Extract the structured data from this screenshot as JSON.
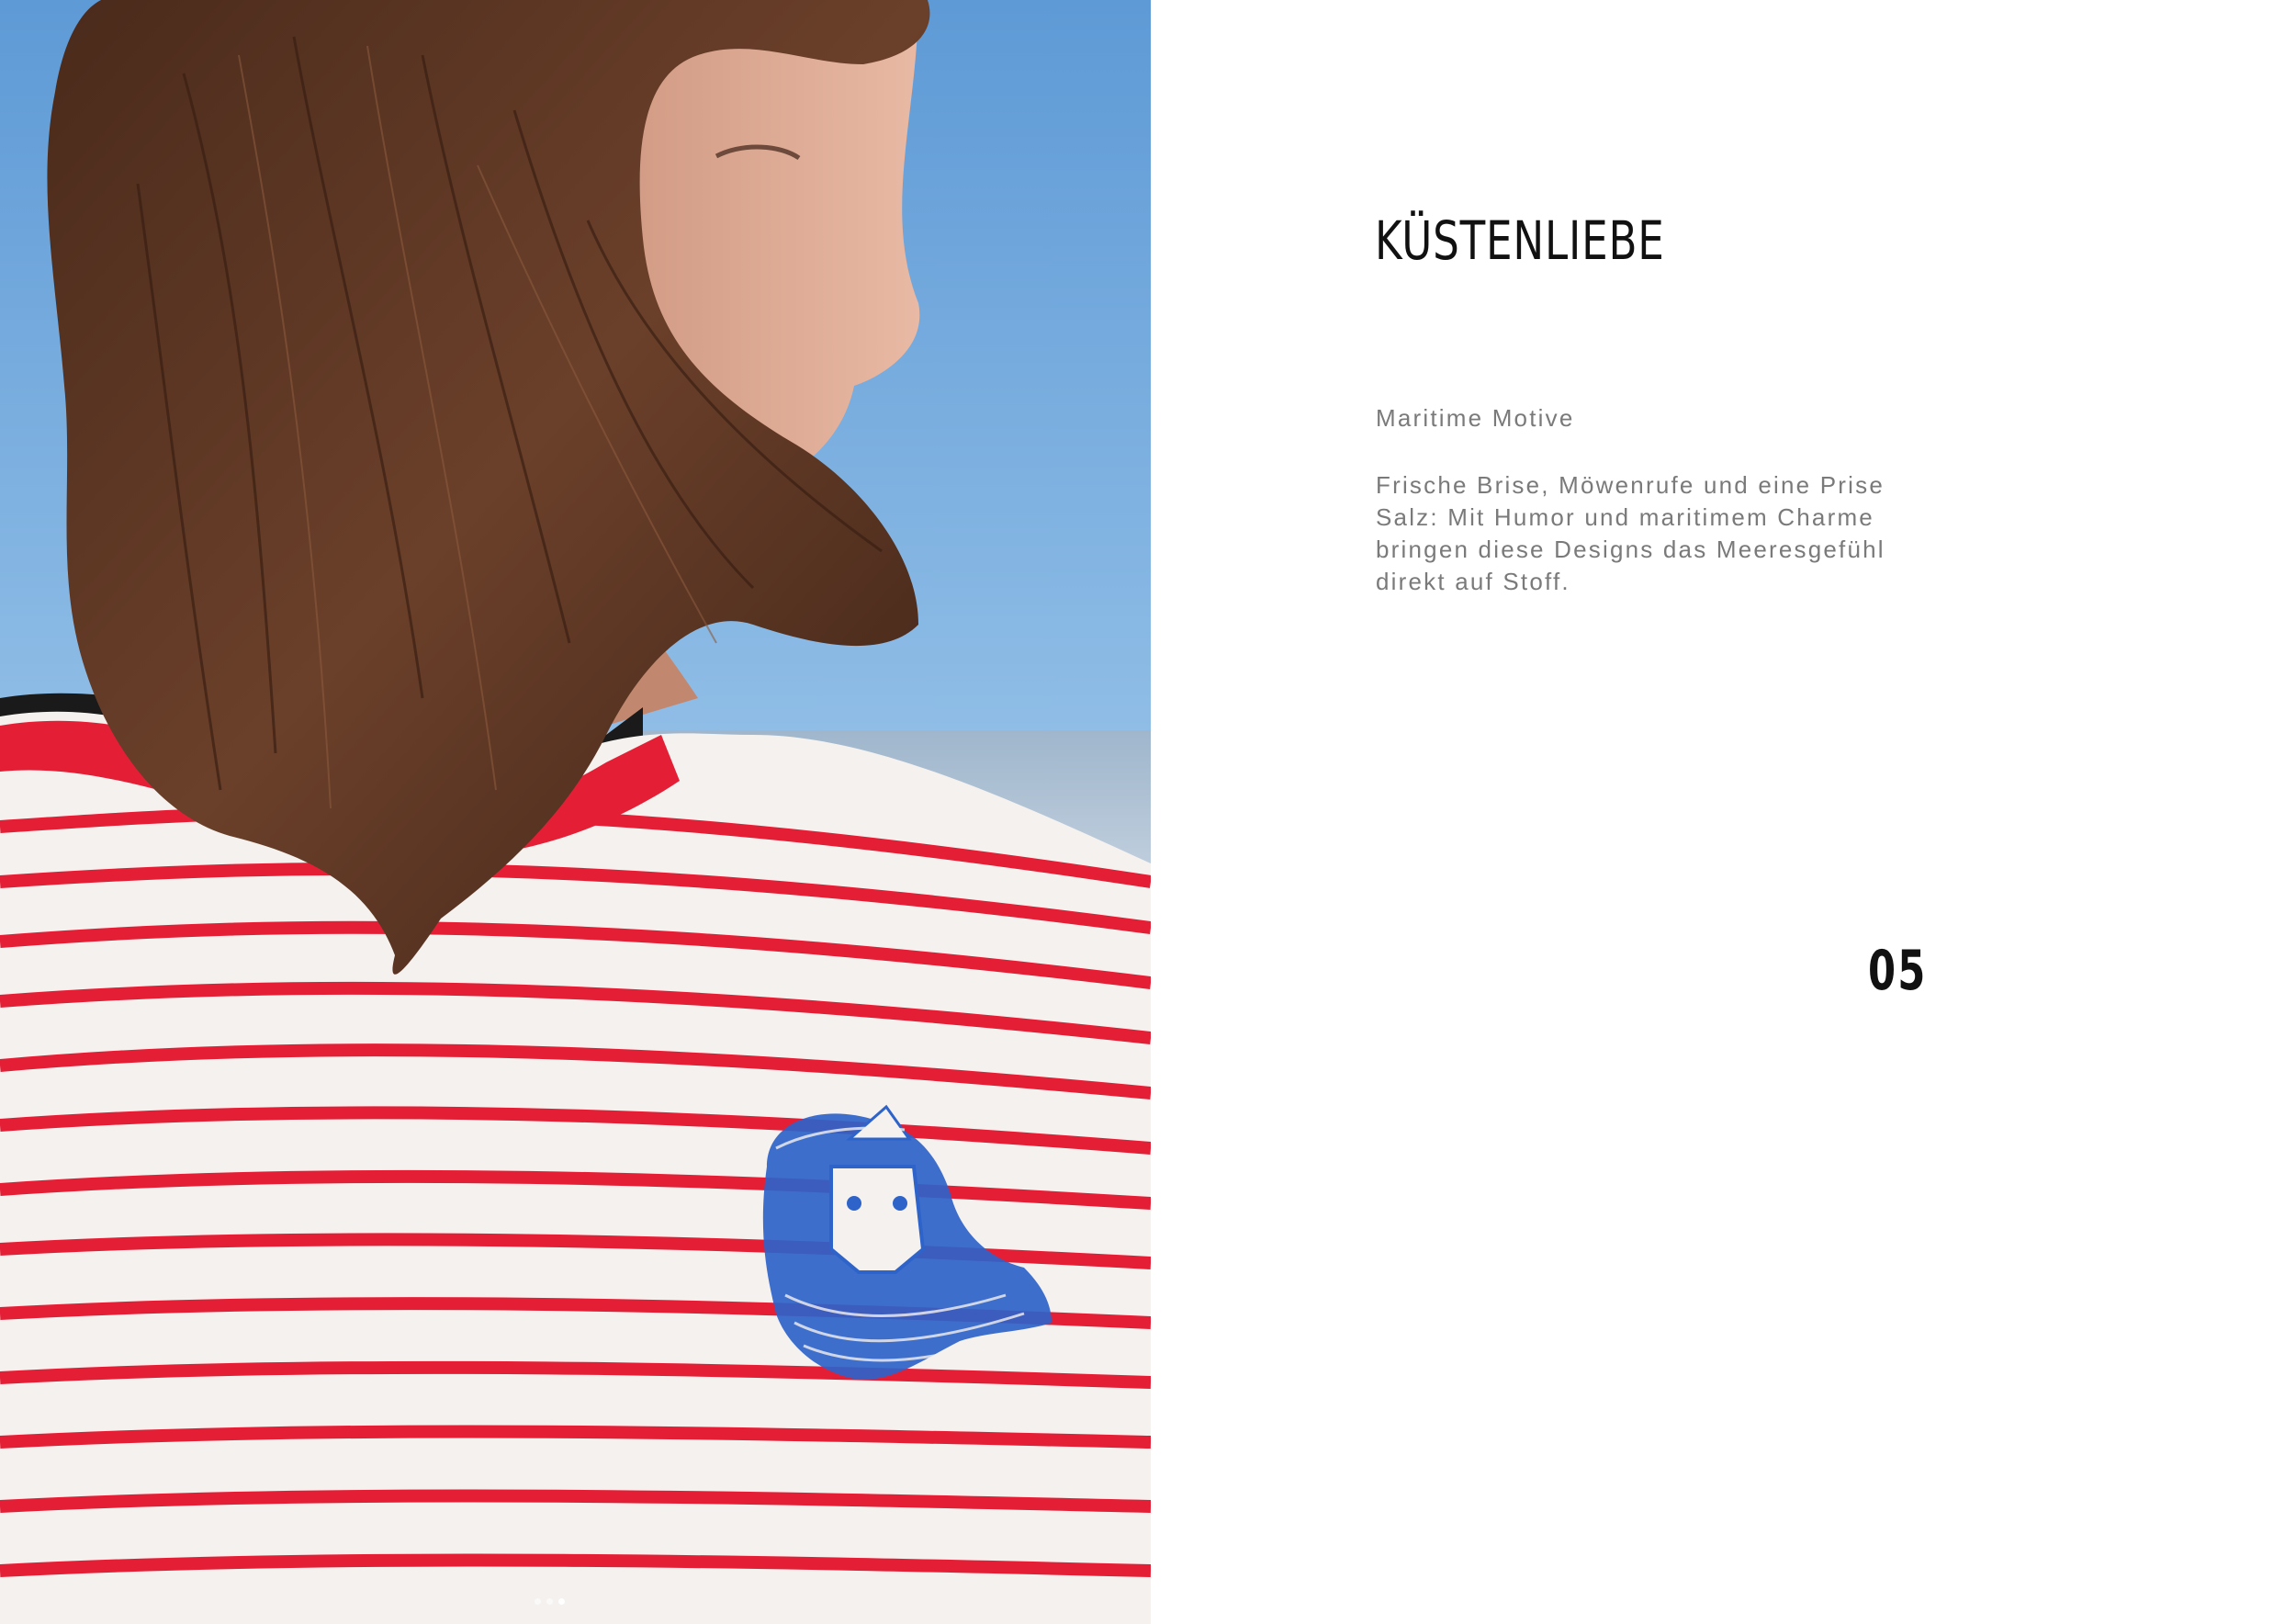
{
  "photo": {
    "icon": "woman-in-striped-shirt-photo",
    "sky_color": "#8cbce6",
    "sea_color": "#c9d6e2",
    "hair_color": "#5a3523",
    "stripe_color": "#e41f35",
    "print_color": "#2e63c9",
    "carousel": {
      "total": 3,
      "active": 3
    }
  },
  "content": {
    "title": "KÜSTENLIEBE",
    "subtitle": "Maritime Motive",
    "description": "Frische Brise, Möwenrufe und eine Prise Salz: Mit Humor und maritimem Charme bringen diese Designs das Meeresgefühl direkt auf Stoff.",
    "page_number": "05"
  }
}
